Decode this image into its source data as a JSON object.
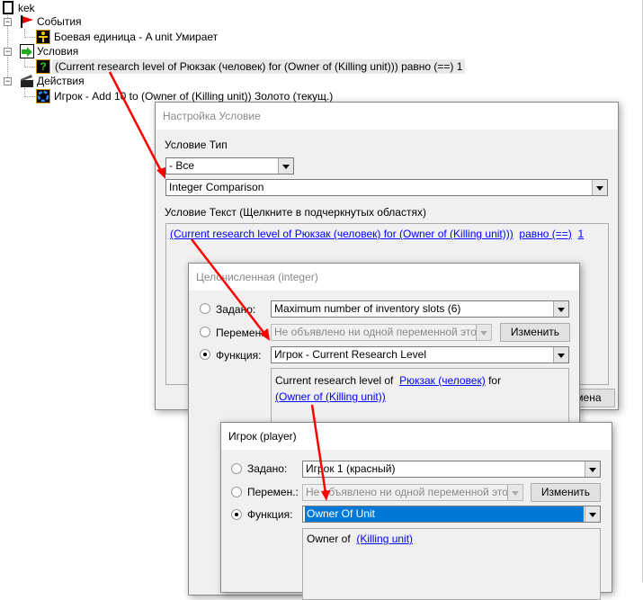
{
  "tree": {
    "root": "kek",
    "events_label": "События",
    "event_item": "Боевая единица - A unit Умирает",
    "conditions_label": "Условия",
    "condition_item": "(Current research level of Рюкзак (человек) for (Owner of (Killing unit))) равно (==) 1",
    "actions_label": "Действия",
    "action_item": "Игрок - Add 10 to (Owner of (Killing unit)) Золото (текущ.)"
  },
  "dialog1": {
    "title": "Настройка Условие",
    "type_label": "Условие Тип",
    "category_value": "- Все",
    "type_value": "Integer Comparison",
    "text_label": "Условие Текст (Щелкните в подчеркнутых областях)",
    "link1": "(Current research level of Рюкзак (человек) for (Owner of (Killing unit)))",
    "link2": "равно (==)",
    "link3": "1",
    "cancel_button": "Отмена"
  },
  "dialog2": {
    "title": "Целочисленная (integer)",
    "preset_label": "Задано:",
    "preset_value": "Maximum number of inventory slots (6)",
    "variable_label": "Перемен.:",
    "variable_value": "Не объявлено ни одной переменной этого типа",
    "edit_button": "Изменить",
    "function_label": "Функция:",
    "function_value": "Игрок - Current Research Level",
    "text_prefix": "Current research level of",
    "link1": "Рюкзак (человек)",
    "text_mid": "for",
    "link2": "(Owner of (Killing unit))"
  },
  "dialog3": {
    "title": "Игрок (player)",
    "preset_label": "Задано:",
    "preset_value": "Игрок 1 (красный)",
    "variable_label": "Перемен.:",
    "variable_value": "Не объявлено ни одной переменной этого типа",
    "edit_button": "Изменить",
    "function_label": "Функция:",
    "function_value": "Owner Of Unit",
    "text_prefix": "Owner of",
    "link1": "(Killing unit)"
  },
  "colors": {
    "arrow": "#ff0000",
    "selection": "#0078d7",
    "link": "#0000ff"
  }
}
